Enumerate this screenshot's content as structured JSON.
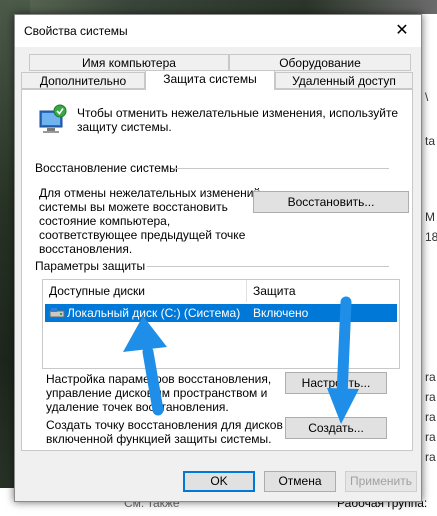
{
  "window": {
    "title": "Свойства системы",
    "close_glyph": "✕"
  },
  "tabs": {
    "row1": [
      "Имя компьютера",
      "Оборудование"
    ],
    "row2": [
      "Дополнительно",
      "Защита системы",
      "Удаленный доступ"
    ],
    "active": "Защита системы"
  },
  "intro": {
    "line1": "Чтобы отменить нежелательные изменения, используйте",
    "line2": "защиту системы."
  },
  "restore": {
    "heading": "Восстановление системы",
    "desc": [
      "Для отмены нежелательных изменений",
      "системы вы можете восстановить",
      "состояние компьютера,",
      "соответствующее предыдущей точке",
      "восстановления."
    ],
    "button": "Восстановить..."
  },
  "protection": {
    "heading": "Параметры защиты",
    "col_drives": "Доступные диски",
    "col_protection": "Защита",
    "drives": [
      {
        "name": "Локальный диск (C:) (Система)",
        "status": "Включено"
      }
    ],
    "configure_desc": [
      "Настройка параметров восстановления,",
      "управление дисковым пространством и",
      "удаление точек восстановления."
    ],
    "configure_button": "Настроить...",
    "create_desc": [
      "Создать точку восстановления для дисков с",
      "включенной функцией защиты системы."
    ],
    "create_button": "Создать..."
  },
  "footer": {
    "ok": "OK",
    "cancel": "Отмена",
    "apply": "Применить"
  },
  "background": {
    "right_chars": [
      "\\",
      "ta",
      "M",
      "18",
      "ra",
      "ra",
      "ra",
      "ra",
      "ra"
    ],
    "see_also": "См. также",
    "workgroup": "Рабочая группа:"
  },
  "colors": {
    "selection": "#0078d7",
    "arrow": "#1e8ee8"
  }
}
